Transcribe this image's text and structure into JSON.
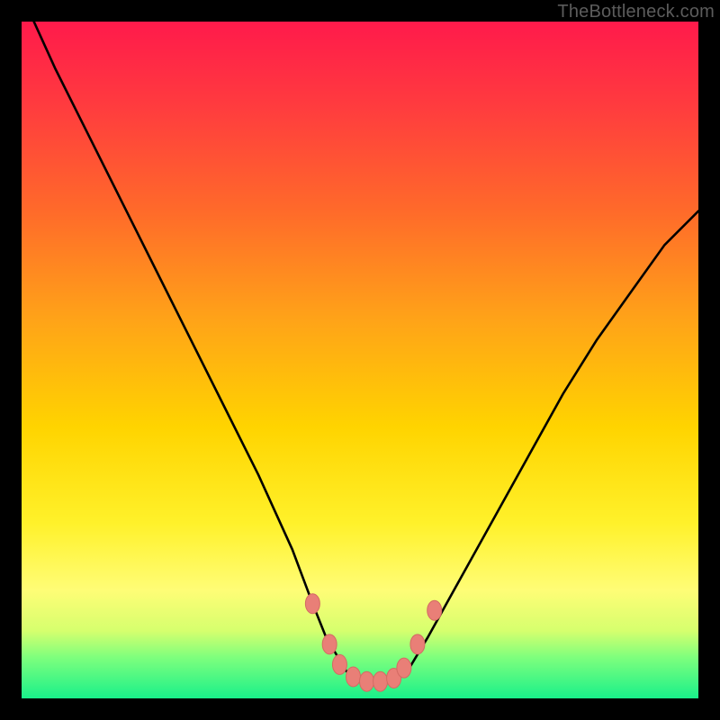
{
  "watermark": "TheBottleneck.com",
  "chart_data": {
    "type": "line",
    "title": "",
    "xlabel": "",
    "ylabel": "",
    "xlim": [
      0,
      100
    ],
    "ylim": [
      0,
      100
    ],
    "grid": false,
    "legend": false,
    "series": [
      {
        "name": "bottleneck-curve",
        "x": [
          0,
          5,
          10,
          15,
          20,
          25,
          30,
          35,
          40,
          43,
          45,
          48,
          50,
          52,
          55,
          57,
          60,
          65,
          70,
          75,
          80,
          85,
          90,
          95,
          100
        ],
        "values": [
          104,
          93,
          83,
          73,
          63,
          53,
          43,
          33,
          22,
          14,
          9,
          4,
          2.5,
          2.3,
          2.5,
          4,
          9,
          18,
          27,
          36,
          45,
          53,
          60,
          67,
          72
        ]
      }
    ],
    "markers": [
      {
        "x": 43.0,
        "y": 14.0
      },
      {
        "x": 45.5,
        "y": 8.0
      },
      {
        "x": 47.0,
        "y": 5.0
      },
      {
        "x": 49.0,
        "y": 3.2
      },
      {
        "x": 51.0,
        "y": 2.5
      },
      {
        "x": 53.0,
        "y": 2.5
      },
      {
        "x": 55.0,
        "y": 3.0
      },
      {
        "x": 56.5,
        "y": 4.5
      },
      {
        "x": 58.5,
        "y": 8.0
      },
      {
        "x": 61.0,
        "y": 13.0
      }
    ],
    "gradient_stops": [
      {
        "pos": 0.0,
        "color": "#ff1a4b"
      },
      {
        "pos": 0.12,
        "color": "#ff3a3f"
      },
      {
        "pos": 0.28,
        "color": "#ff6a2a"
      },
      {
        "pos": 0.44,
        "color": "#ffa318"
      },
      {
        "pos": 0.6,
        "color": "#ffd400"
      },
      {
        "pos": 0.74,
        "color": "#fff12a"
      },
      {
        "pos": 0.84,
        "color": "#fffd76"
      },
      {
        "pos": 0.9,
        "color": "#d6ff6e"
      },
      {
        "pos": 0.94,
        "color": "#7dff7d"
      },
      {
        "pos": 1.0,
        "color": "#19f08a"
      }
    ]
  }
}
